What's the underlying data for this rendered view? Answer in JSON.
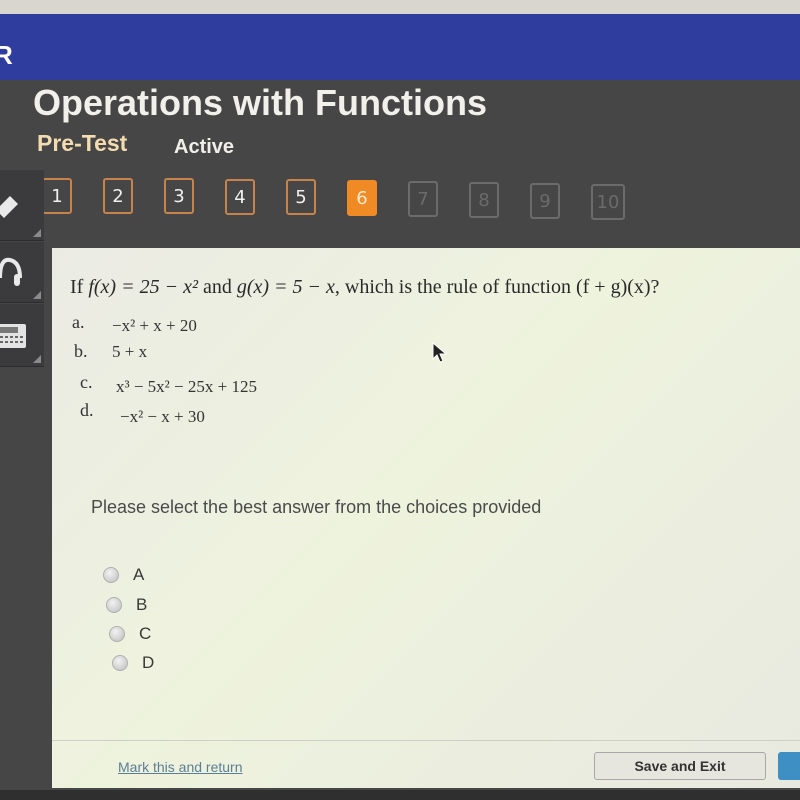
{
  "header": {
    "logo_fragment": "R",
    "title": "Operations with Functions",
    "subtitle": "Pre-Test",
    "status": "Active",
    "brand_color": "#2f3e9e",
    "accent_color": "#f08a24"
  },
  "question_nav": {
    "current": 6,
    "items": [
      {
        "label": "1",
        "state": "visited"
      },
      {
        "label": "2",
        "state": "visited"
      },
      {
        "label": "3",
        "state": "visited"
      },
      {
        "label": "4",
        "state": "visited"
      },
      {
        "label": "5",
        "state": "visited"
      },
      {
        "label": "6",
        "state": "current"
      },
      {
        "label": "7",
        "state": "locked"
      },
      {
        "label": "8",
        "state": "locked"
      },
      {
        "label": "9",
        "state": "locked"
      },
      {
        "label": "10",
        "state": "locked"
      }
    ]
  },
  "sidebar": {
    "tools": [
      {
        "icon": "pencil-icon"
      },
      {
        "icon": "headphones-icon"
      },
      {
        "icon": "calculator-icon"
      }
    ]
  },
  "question": {
    "text_parts": {
      "lead": "If ",
      "f_def": "f(x) = 25 − x² ",
      "and": "and ",
      "g_def": "g(x) = 5 − x",
      "tail": ", which is the rule of function (f + g)(x)?"
    },
    "choices": [
      {
        "letter": "a.",
        "expression": "−x² + x + 20"
      },
      {
        "letter": "b.",
        "expression": "5 + x"
      },
      {
        "letter": "c.",
        "expression": "x³ − 5x² − 25x + 125"
      },
      {
        "letter": "d.",
        "expression": "−x² − x + 30"
      }
    ]
  },
  "answer": {
    "prompt": "Please select the best answer from the choices provided",
    "options": [
      "A",
      "B",
      "C",
      "D"
    ],
    "selected": null
  },
  "footer": {
    "mark_link": "Mark this and return",
    "save_exit": "Save and Exit"
  }
}
